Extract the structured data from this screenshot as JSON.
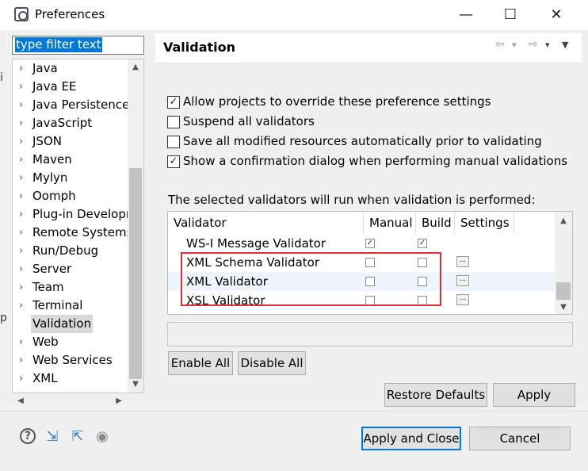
{
  "window": {
    "title": "Preferences",
    "controls": {
      "minimize": "—",
      "maximize": "☐",
      "close": "✕"
    }
  },
  "filter": {
    "value": "type filter text"
  },
  "tree": {
    "items": [
      {
        "label": "Java",
        "expanded": false
      },
      {
        "label": "Java EE",
        "expanded": false
      },
      {
        "label": "Java Persistence",
        "expanded": false
      },
      {
        "label": "JavaScript",
        "expanded": false
      },
      {
        "label": "JSON",
        "expanded": false
      },
      {
        "label": "Maven",
        "expanded": false
      },
      {
        "label": "Mylyn",
        "expanded": false
      },
      {
        "label": "Oomph",
        "expanded": false
      },
      {
        "label": "Plug-in Developr",
        "expanded": false
      },
      {
        "label": "Remote Systems",
        "expanded": false
      },
      {
        "label": "Run/Debug",
        "expanded": false
      },
      {
        "label": "Server",
        "expanded": false
      },
      {
        "label": "Team",
        "expanded": false
      },
      {
        "label": "Terminal",
        "expanded": false
      },
      {
        "label": "Validation",
        "expanded": null,
        "selected": true
      },
      {
        "label": "Web",
        "expanded": false
      },
      {
        "label": "Web Services",
        "expanded": false
      },
      {
        "label": "XML",
        "expanded": false
      }
    ],
    "arrow_glyph": "›"
  },
  "page": {
    "title": "Validation",
    "nav": {
      "back": "⇦",
      "back_menu": "▾",
      "forward": "⇨",
      "forward_menu": "▾",
      "view_menu": "▼"
    }
  },
  "options": [
    {
      "label": "Allow projects to override these preference settings",
      "checked": true
    },
    {
      "label": "Suspend all validators",
      "checked": false
    },
    {
      "label": "Save all modified resources automatically prior to validating",
      "checked": false
    },
    {
      "label": "Show a confirmation dialog when performing manual validations",
      "checked": true
    }
  ],
  "validators": {
    "intro": "The selected validators will run when validation is performed:",
    "columns": [
      "Validator",
      "Manual",
      "Build",
      "Settings"
    ],
    "rows": [
      {
        "name": "WS-I Message Validator",
        "manual": true,
        "build": true,
        "settings": false
      },
      {
        "name": "XML Schema Validator",
        "manual": false,
        "build": false,
        "settings": true
      },
      {
        "name": "XML Validator",
        "manual": false,
        "build": false,
        "settings": true
      },
      {
        "name": "XSL Validator",
        "manual": false,
        "build": false,
        "settings": true
      }
    ],
    "settings_glyph": "..."
  },
  "buttons": {
    "enable_all": "Enable All",
    "disable_all": "Disable All",
    "restore_defaults": "Restore Defaults",
    "apply": "Apply",
    "apply_and_close": "Apply and Close",
    "cancel": "Cancel"
  },
  "footer_icons": {
    "help": "?",
    "import": "⇲",
    "export": "⇱",
    "record": "◉"
  },
  "colors": {
    "accent": "#0078d7",
    "highlight": "#e02f36",
    "selection": "#d9d9d9"
  }
}
